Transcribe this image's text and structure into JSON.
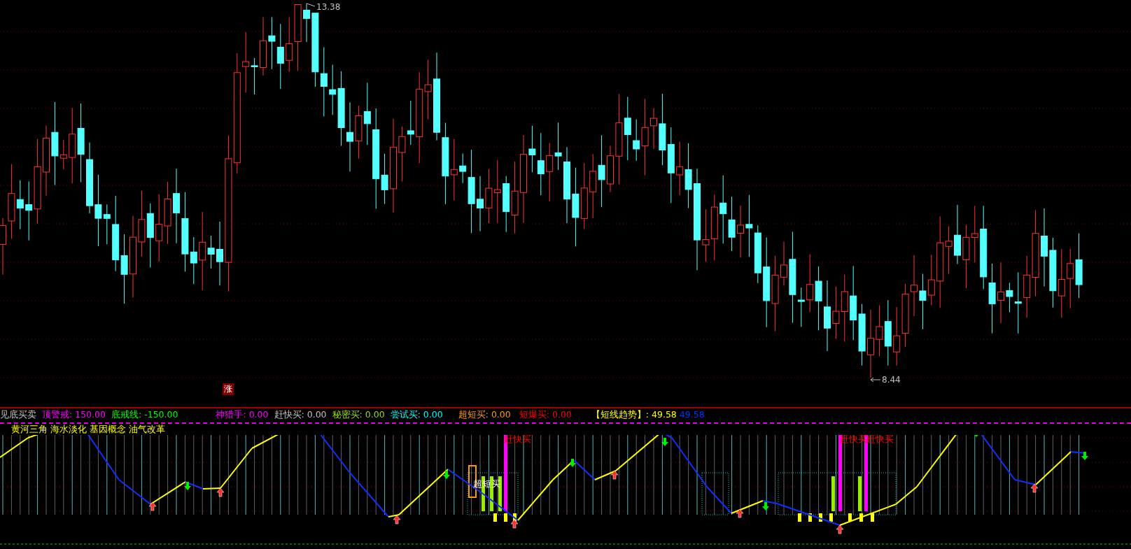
{
  "price_chart": {
    "high_label": "13.38",
    "low_label": "8.44",
    "marker": "涨"
  },
  "indicator_legend": [
    {
      "label": "见底买卖",
      "color": "#c0c0c0"
    },
    {
      "label": "顶警戒:",
      "color": "#ff00ff",
      "values": [
        {
          "text": "150.00",
          "color": "#ff00ff"
        }
      ]
    },
    {
      "label": "底戒线:",
      "color": "#00ff00",
      "values": [
        {
          "text": "-150.00",
          "color": "#00ff00"
        }
      ]
    },
    {
      "label": "神猎手:",
      "color": "#ff00ff",
      "values": [
        {
          "text": "0.00",
          "color": "#ff00ff"
        }
      ]
    },
    {
      "label": "赶快买:",
      "color": "#c0c0c0",
      "values": [
        {
          "text": "0.00",
          "color": "#c0c0c0"
        }
      ]
    },
    {
      "label": "秘密买:",
      "color": "#99dd00",
      "values": [
        {
          "text": "0.00",
          "color": "#99dd00"
        }
      ]
    },
    {
      "label": "尝试买:",
      "color": "#00ffff",
      "values": [
        {
          "text": "0.00",
          "color": "#00ffff"
        }
      ]
    },
    {
      "label": "超短买:",
      "color": "#ff9900",
      "values": [
        {
          "text": "0.00",
          "color": "#ff9900"
        }
      ]
    },
    {
      "label": "短爆买:",
      "color": "#ff0000",
      "values": [
        {
          "text": "0.00",
          "color": "#ff0000"
        }
      ]
    },
    {
      "label": "【短线趋势】:",
      "color": "#ffff00",
      "values": [
        {
          "text": "49.58",
          "color": "#ffff00"
        },
        {
          "text": "49.58",
          "color": "#0033ff"
        }
      ]
    }
  ],
  "concepts": "黄河三角 海水淡化 基因概念 油气改革",
  "signals": [
    {
      "text": "超短买",
      "kind": "white"
    },
    {
      "text": "赶快买",
      "kind": "red"
    },
    {
      "text": "赶快买",
      "kind": "red"
    },
    {
      "text": "赶快买",
      "kind": "red"
    }
  ]
}
